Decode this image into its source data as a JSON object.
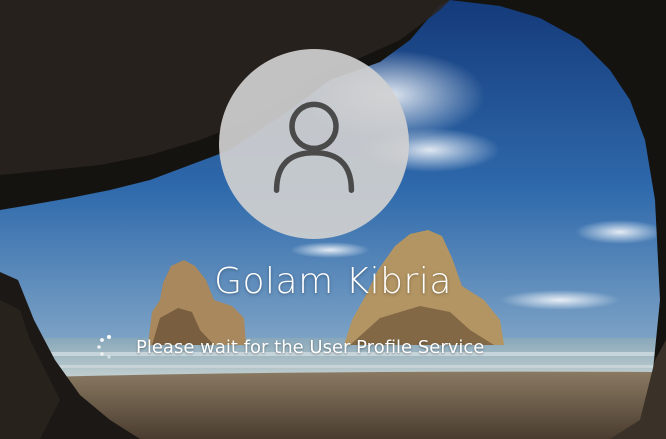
{
  "login": {
    "username": "Golam Kibria",
    "status_message": "Please wait for the User Profile Service"
  },
  "icons": {
    "avatar": "user-silhouette-icon",
    "spinner": "loading-spinner-icon"
  },
  "colors": {
    "avatar_circle": "#d0d0d0",
    "avatar_glyph": "#4a4a4a",
    "text": "#ffffff",
    "sky": "#2a63a6",
    "sea": "#9bb7c4",
    "sand": "#6b5744",
    "cave": "#161412"
  }
}
